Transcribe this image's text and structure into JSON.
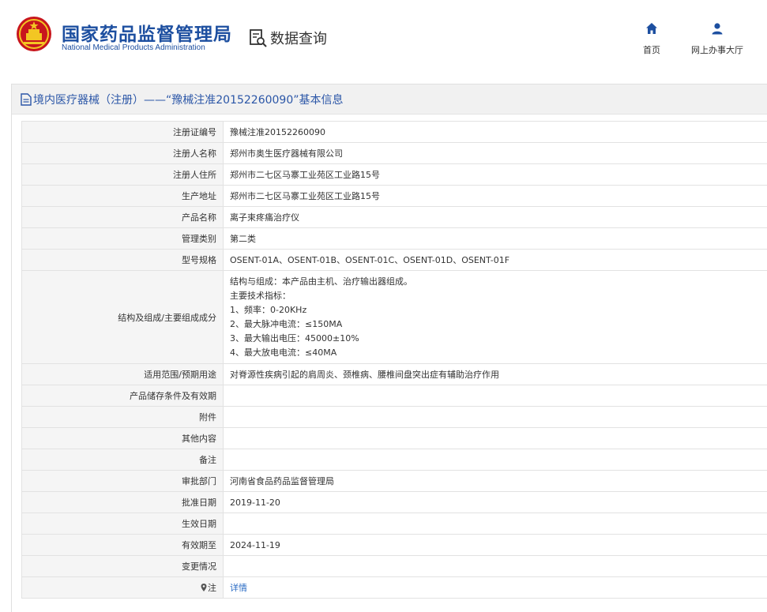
{
  "header": {
    "org_name_cn": "国家药品监督管理局",
    "org_name_en": "National Medical Products Administration",
    "section_title": "数据查询",
    "nav": {
      "home_label": "首页",
      "service_hall_label": "网上办事大厅"
    }
  },
  "panel": {
    "title": "境内医疗器械（注册）——“豫械注准20152260090”基本信息"
  },
  "rows": [
    {
      "label": "注册证编号",
      "value": "豫械注准20152260090"
    },
    {
      "label": "注册人名称",
      "value": "郑州市奥生医疗器械有限公司"
    },
    {
      "label": "注册人住所",
      "value": "郑州市二七区马寨工业苑区工业路15号"
    },
    {
      "label": "生产地址",
      "value": "郑州市二七区马寨工业苑区工业路15号"
    },
    {
      "label": "产品名称",
      "value": "离子束疼痛治疗仪"
    },
    {
      "label": "管理类别",
      "value": "第二类"
    },
    {
      "label": "型号规格",
      "value": "OSENT-01A、OSENT-01B、OSENT-01C、OSENT-01D、OSENT-01F"
    },
    {
      "label": "结构及组成/主要组成成分",
      "lines": [
        "结构与组成：本产品由主机、治疗输出器组成。",
        "主要技术指标：",
        "1、频率：0-20KHz",
        "2、最大脉冲电流：≤150MA",
        "3、最大输出电压：45000±10%",
        "4、最大放电电流：≤40MA"
      ]
    },
    {
      "label": "适用范围/预期用途",
      "value": "对脊源性疾病引起的肩周炎、颈椎病、腰椎间盘突出症有辅助治疗作用"
    },
    {
      "label": "产品储存条件及有效期",
      "value": ""
    },
    {
      "label": "附件",
      "value": ""
    },
    {
      "label": "其他内容",
      "value": ""
    },
    {
      "label": "备注",
      "value": ""
    },
    {
      "label": "审批部门",
      "value": "河南省食品药品监督管理局"
    },
    {
      "label": "批准日期",
      "value": "2019-11-20"
    },
    {
      "label": "生效日期",
      "value": ""
    },
    {
      "label": "有效期至",
      "value": "2024-11-19"
    },
    {
      "label": "变更情况",
      "value": ""
    },
    {
      "label": "注",
      "value": "详情"
    }
  ],
  "colors": {
    "brand_blue": "#1d4fa0",
    "link_blue": "#2b6cc4",
    "label_bg": "#f5f5f5"
  }
}
